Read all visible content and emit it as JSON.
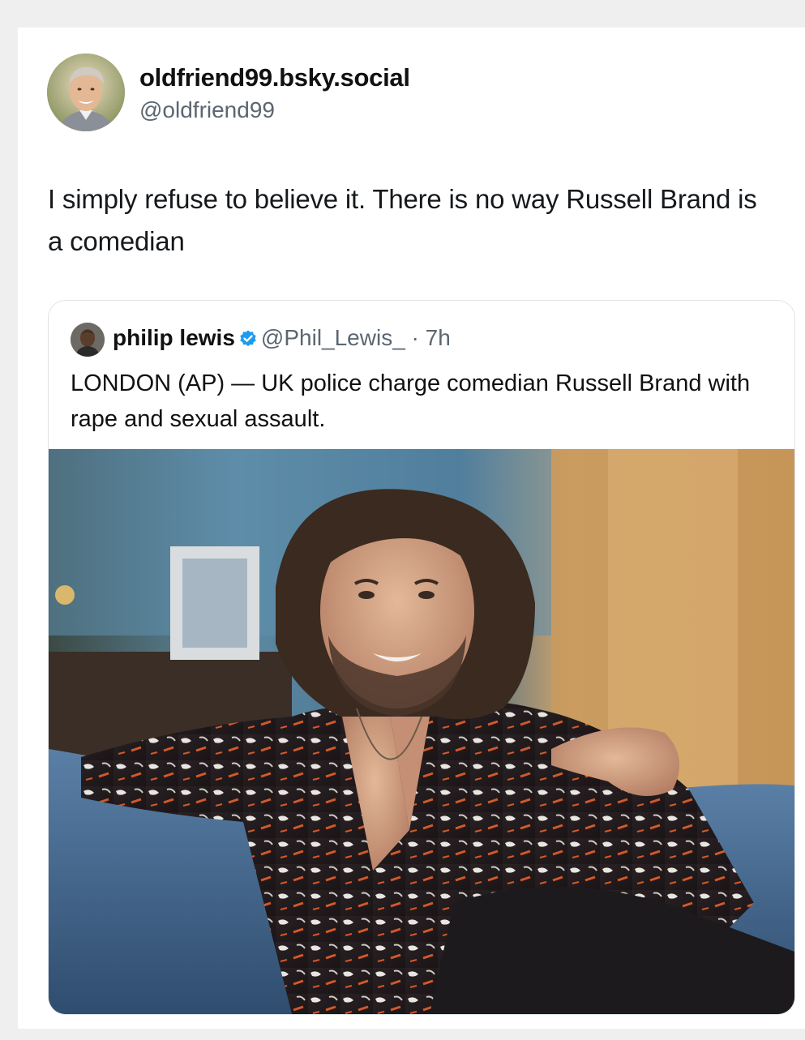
{
  "post": {
    "display_name": "oldfriend99.bsky.social",
    "handle": "@oldfriend99",
    "text": "I simply refuse to believe it. There is no way Russell Brand is a comedian"
  },
  "quoted_post": {
    "display_name": "philip lewis",
    "handle": "@Phil_Lewis_",
    "separator": " · ",
    "time": "7h",
    "text": "LONDON (AP) — UK police charge comedian Russell Brand with rape and sexual assault."
  },
  "icons": {
    "verified": "verified-badge-icon"
  },
  "colors": {
    "verified_blue": "#1d9bf0",
    "handle_gray": "#5b6672",
    "border": "#dfe3e7"
  }
}
